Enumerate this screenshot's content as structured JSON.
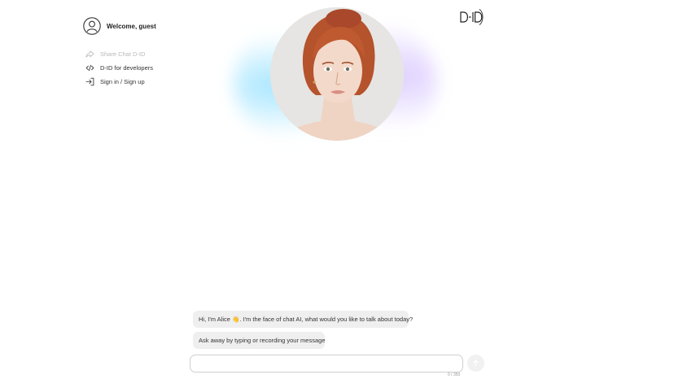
{
  "sidebar": {
    "welcome": "Welcome, guest",
    "items": [
      {
        "label": "Share Chat D-ID",
        "icon": "share-icon",
        "disabled": true
      },
      {
        "label": "D-ID for developers",
        "icon": "code-icon",
        "disabled": false
      },
      {
        "label": "Sign in / Sign up",
        "icon": "sign-in-icon",
        "disabled": false
      }
    ]
  },
  "brand": {
    "logo_text": "D-ID"
  },
  "chat": {
    "messages": [
      "Hi, I'm Alice 👋. I'm the face of chat AI, what would you like to talk about today?",
      "Ask away by typing or recording your message"
    ],
    "input": {
      "value": "",
      "placeholder": ""
    },
    "counter": "0 / 350"
  },
  "colors": {
    "glow_cyan": "#96e1ff",
    "glow_lavender": "#d2beff",
    "bubble_bg": "#efefef",
    "disabled_text": "#b9b9b9"
  }
}
